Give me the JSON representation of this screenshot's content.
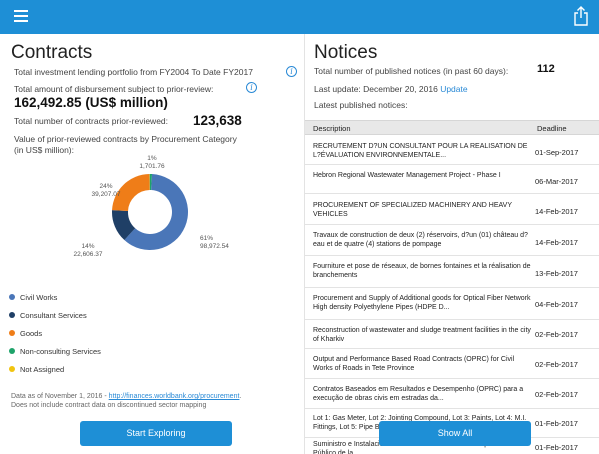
{
  "header": {
    "menu_icon": "hamburger-icon",
    "share_icon": "share-icon",
    "bg": "#1e8fd6"
  },
  "contracts": {
    "title": "Contracts",
    "portfolio_text": "Total investment lending portfolio from FY2004 To Date FY2017",
    "disbursement_label": "Total amount of disbursement subject to prior-review:",
    "disbursement_value": "162,492.85 (US$ million)",
    "prior_reviewed_label": "Total number of contracts prior-reviewed:",
    "prior_reviewed_value": "123,638",
    "chart_caption_1": "Value of prior-reviewed contracts by Procurement Category",
    "chart_caption_2": "(in US$ million):",
    "legend": [
      {
        "label": "Civil Works",
        "color": "#4a76b8"
      },
      {
        "label": "Consultant Services",
        "color": "#1f3f66"
      },
      {
        "label": "Goods",
        "color": "#ef7d18"
      },
      {
        "label": "Non-consulting Services",
        "color": "#1ea36a"
      },
      {
        "label": "Not Assigned",
        "color": "#f1c40f"
      }
    ],
    "footnote_1_prefix": "Data as of November 1, 2016 - ",
    "footnote_1_link": "http://finances.worldbank.org/procurement",
    "footnote_1_suffix": ".",
    "footnote_2": "Does not include contract data on discontinued sector mapping",
    "explore_button": "Start Exploring"
  },
  "chart_data": {
    "type": "pie",
    "slices": [
      {
        "label": "Civil Works",
        "percent": "61%",
        "value": "98,972.54",
        "pct": 61,
        "color": "#4a76b8"
      },
      {
        "label": "Consultant Services",
        "percent": "14%",
        "value": "22,606.37",
        "pct": 14,
        "color": "#1f3f66"
      },
      {
        "label": "Goods",
        "percent": "24%",
        "value": "39,207.07",
        "pct": 24,
        "color": "#ef7d18"
      },
      {
        "label": "Non-consulting Services",
        "percent": "1%",
        "value": "1,701.76",
        "pct": 1,
        "color": "#1ea36a"
      },
      {
        "label": "Not Assigned",
        "percent": "",
        "value": "",
        "pct": 0.1,
        "color": "#f1c40f"
      }
    ]
  },
  "notices": {
    "title": "Notices",
    "published_label": "Total number of published notices (in past 60 days):",
    "published_value": "112",
    "last_update_label": "Last update: December 20, 2016",
    "update_link": "Update",
    "latest_label": "Latest published notices:",
    "col_description": "Description",
    "col_deadline": "Deadline",
    "rows": [
      {
        "desc": "RECRUTEMENT D?UN CONSULTANT POUR LA REALISATION DE L?ÉVALUATION ENVIRONNEMENTALE...",
        "date": "01-Sep-2017"
      },
      {
        "desc": "Hebron Regional Wastewater Management Project - Phase I",
        "date": "06-Mar-2017"
      },
      {
        "desc": "PROCUREMENT OF SPECIALIZED MACHINERY AND HEAVY VEHICLES",
        "date": "14-Feb-2017"
      },
      {
        "desc": "Travaux de construction de deux (2) réservoirs, d?un (01) château d?eau et de quatre (4) stations de pompage",
        "date": "14-Feb-2017"
      },
      {
        "desc": "Fourniture et pose de réseaux, de bornes fontaines et la réalisation de branchements",
        "date": "13-Feb-2017"
      },
      {
        "desc": "Procurement and Supply of Additional goods for Optical Fiber Network High density Polyethylene Pipes (HDPE D...",
        "date": "04-Feb-2017"
      },
      {
        "desc": "Reconstruction of wastewater and sludge treatment facilities in the city of Kharkiv",
        "date": "02-Feb-2017"
      },
      {
        "desc": "Output and Performance Based Road Contracts (OPRC) for Civil Works of Roads in Tete Province",
        "date": "02-Feb-2017"
      },
      {
        "desc": "Contratos Baseados em Resultados e Desempenho (OPRC) para a execução de obras civis em estradas da...",
        "date": "02-Feb-2017"
      },
      {
        "desc": "Lot 1: Gas Meter, Lot 2: Jointing Compound, Lot 3: Paints, Lot 4: M.I. Fittings, Lot 5: Pipe Bracket, Lot 6: Wall S...",
        "date": "01-Feb-2017"
      },
      {
        "desc": "Suministro e Instalación... Contrataciones Electrónicas para el Sector Público de la...",
        "date": "01-Feb-2017"
      }
    ],
    "show_all_button": "Show All"
  }
}
